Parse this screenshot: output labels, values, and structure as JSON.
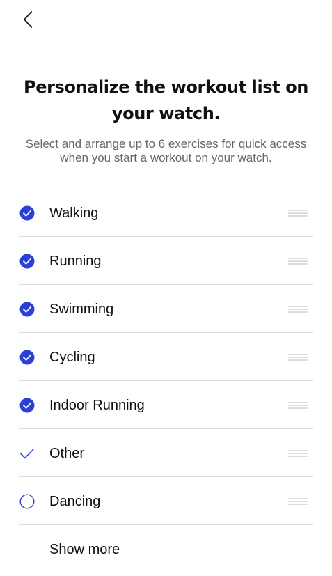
{
  "header": {
    "back_icon": "chevron-left-icon"
  },
  "title": "Personalize the workout list on your watch.",
  "subtitle": "Select and arrange up to 6 exercises for quick access when you start a workout on your watch.",
  "accent_color": "#2B3FD6",
  "workouts": [
    {
      "label": "Walking",
      "state": "checked"
    },
    {
      "label": "Running",
      "state": "checked"
    },
    {
      "label": "Swimming",
      "state": "checked"
    },
    {
      "label": "Cycling",
      "state": "checked"
    },
    {
      "label": "Indoor Running",
      "state": "checked"
    },
    {
      "label": "Other",
      "state": "checkmark-only"
    },
    {
      "label": "Dancing",
      "state": "unchecked"
    }
  ],
  "show_more_label": "Show more"
}
